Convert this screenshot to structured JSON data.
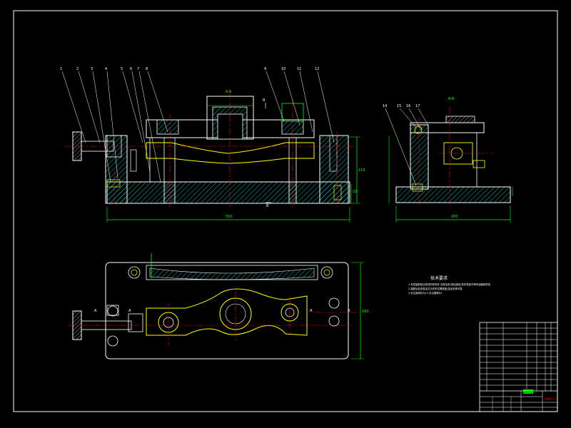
{
  "drawing": {
    "callouts_front": [
      "1",
      "2",
      "3",
      "4",
      "5",
      "6",
      "7",
      "8",
      "9",
      "10",
      "11",
      "12",
      "13"
    ],
    "callouts_side": [
      "14",
      "15",
      "16",
      "17"
    ],
    "section_labels": {
      "a_a": "A-A",
      "b_b": "B-B",
      "b_top": "B",
      "b_bottom": "B",
      "a_left_1": "A",
      "a_left_2": "A",
      "a_right_1": "A",
      "a_right_2": "A"
    },
    "dimensions": {
      "front_width": "550",
      "front_height_1": "110",
      "front_height_2": "22",
      "side_width": "200",
      "plan_height": "160"
    },
    "tech_req": {
      "title": "技术要求",
      "lines": [
        "1.夹具装配前应清洗所有零件,去除毛刺,锐边倒钝,零件表面不得有划痕和损伤.",
        "2.装配后检查各定位元件的位置精度,保证夹紧可靠.",
        "3.未注倒角均为C1,未注圆角R2."
      ]
    },
    "title_block": {
      "drawing_name": "夹具装配图",
      "company": "机械制造工艺"
    }
  },
  "colors": {
    "background": "#000000",
    "outline": "#ffffff",
    "dimension": "#00ff00",
    "workpiece": "#ffff00",
    "centerline": "#ff0000",
    "hatch": "#00ffff",
    "callout": "#ffffff"
  }
}
